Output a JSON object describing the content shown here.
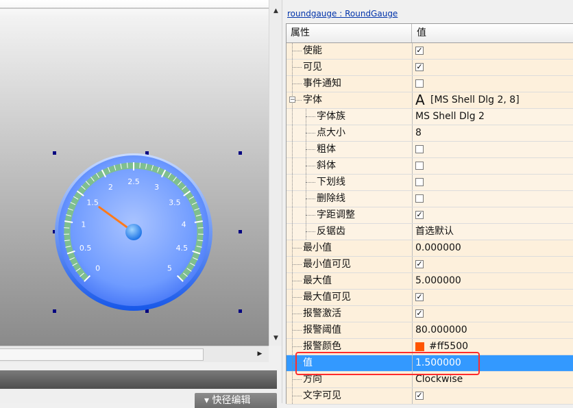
{
  "object_title": "roundgauge : RoundGauge",
  "grid_header": {
    "property": "属性",
    "value": "值"
  },
  "properties": [
    {
      "name": "使能",
      "type": "check",
      "checked": true
    },
    {
      "name": "可见",
      "type": "check",
      "checked": true
    },
    {
      "name": "事件通知",
      "type": "check",
      "checked": false
    },
    {
      "name": "字体",
      "type": "font",
      "value": "[MS Shell Dlg 2, 8]",
      "icon": "A"
    },
    {
      "name": "字体族",
      "type": "text",
      "value": "MS Shell Dlg 2",
      "child": true
    },
    {
      "name": "点大小",
      "type": "text",
      "value": "8",
      "child": true
    },
    {
      "name": "粗体",
      "type": "check",
      "checked": false,
      "child": true
    },
    {
      "name": "斜体",
      "type": "check",
      "checked": false,
      "child": true
    },
    {
      "name": "下划线",
      "type": "check",
      "checked": false,
      "child": true
    },
    {
      "name": "删除线",
      "type": "check",
      "checked": false,
      "child": true
    },
    {
      "name": "字距调整",
      "type": "check",
      "checked": true,
      "child": true
    },
    {
      "name": "反锯齿",
      "type": "text",
      "value": "首选默认",
      "child": true
    },
    {
      "name": "最小值",
      "type": "text",
      "value": "0.000000"
    },
    {
      "name": "最小值可见",
      "type": "check",
      "checked": true
    },
    {
      "name": "最大值",
      "type": "text",
      "value": "5.000000"
    },
    {
      "name": "最大值可见",
      "type": "check",
      "checked": true
    },
    {
      "name": "报警激活",
      "type": "check",
      "checked": true
    },
    {
      "name": "报警阈值",
      "type": "text",
      "value": "80.000000"
    },
    {
      "name": "报警颜色",
      "type": "color",
      "value": "#ff5500",
      "color": "#ff5500"
    },
    {
      "name": "值",
      "type": "text",
      "value": "1.500000",
      "selected": true
    },
    {
      "name": "方向",
      "type": "text",
      "value": "Clockwise"
    },
    {
      "name": "文字可见",
      "type": "check",
      "checked": true
    }
  ],
  "gauge": {
    "min": 0,
    "max": 5,
    "value": 1.5,
    "tick_labels": [
      "0",
      "0.5",
      "1",
      "1.5",
      "2",
      "2.5",
      "3",
      "3.5",
      "4",
      "4.5",
      "5"
    ],
    "needle_color": "#ff7a1a",
    "face_color": "#5b8cff",
    "band_color": "#7fbf8f"
  },
  "bottom": {
    "edit_button": "▾ 快径编辑"
  }
}
